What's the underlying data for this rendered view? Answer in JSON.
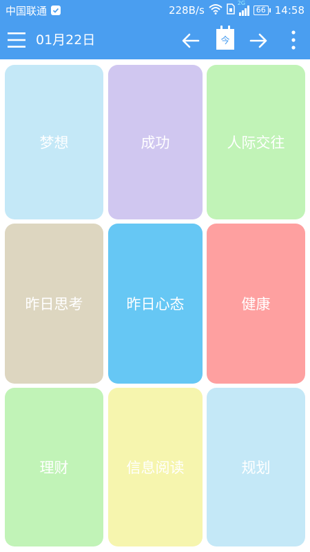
{
  "status_bar": {
    "carrier": "中国联通",
    "net_speed": "228B/s",
    "network_type": "2G",
    "battery": "66",
    "time": "14:58"
  },
  "header": {
    "date": "01月22日",
    "today_label": "今",
    "icons": {
      "menu": "menu-icon",
      "prev": "arrow-left-icon",
      "today": "calendar-today-icon",
      "next": "arrow-right-icon",
      "more": "more-vertical-icon"
    },
    "bg_color": "#4a9ef0"
  },
  "tiles": [
    {
      "label": "梦想",
      "color": "#c4e8f7"
    },
    {
      "label": "成功",
      "color": "#d0c7f0"
    },
    {
      "label": "人际交往",
      "color": "#c1f3b7"
    },
    {
      "label": "昨日思考",
      "color": "#ddd6c0"
    },
    {
      "label": "昨日心态",
      "color": "#66c7f4"
    },
    {
      "label": "健康",
      "color": "#fea0a0"
    },
    {
      "label": "理财",
      "color": "#c1f3b7"
    },
    {
      "label": "信息阅读",
      "color": "#f6f5ae"
    },
    {
      "label": "规划",
      "color": "#c4e8f7"
    }
  ]
}
